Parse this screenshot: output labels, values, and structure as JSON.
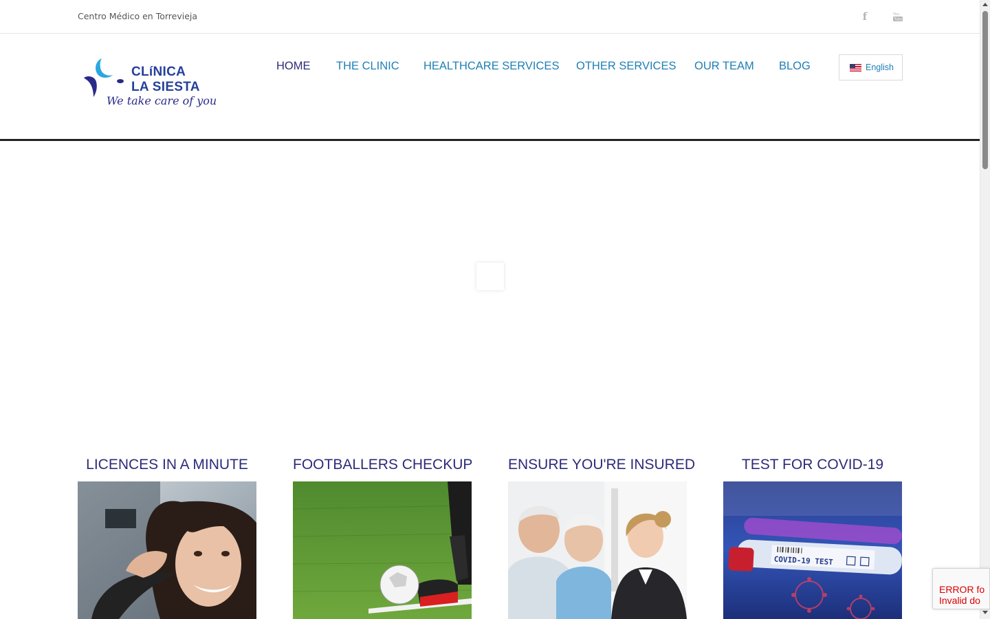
{
  "topbar": {
    "tagline": "Centro Médico en Torrevieja",
    "social": [
      {
        "name": "facebook-icon",
        "glyph": "f"
      },
      {
        "name": "youtube-icon",
        "glyph": "You"
      }
    ]
  },
  "logo": {
    "word1": "CLíNICA",
    "word2": "LA SIESTA",
    "slogan": "We take care of you",
    "colors": {
      "blue": "#253f9b",
      "light_blue": "#29a8e0",
      "navy": "#2a2a8a"
    }
  },
  "nav": {
    "items": [
      {
        "label": "HOME",
        "active": true
      },
      {
        "label": "THE CLINIC",
        "active": false
      },
      {
        "label": "HEALTHCARE SERVICES",
        "active": false
      },
      {
        "label": "OTHER SERVICES",
        "active": false
      },
      {
        "label": "OUR TEAM",
        "active": false
      },
      {
        "label": "BLOG",
        "active": false
      }
    ],
    "language": {
      "label": "English",
      "flag": "us-flag-icon"
    }
  },
  "cards": [
    {
      "title": "LICENCES IN A MINUTE",
      "image": "woman-driving-car"
    },
    {
      "title": "FOOTBALLERS CHECKUP",
      "image": "football-on-grass"
    },
    {
      "title": "ENSURE YOU'RE INSURED",
      "image": "elderly-couple-with-advisor"
    },
    {
      "title": "TEST FOR COVID-19",
      "image": "covid-test-tube"
    }
  ],
  "covid_tube_label": "COVID-19 TEST",
  "recaptcha": {
    "line1": "ERROR fo",
    "line2": "Invalid do"
  },
  "colors": {
    "nav_link": "#1d7fb5",
    "nav_active": "#2b2b7a",
    "card_title": "#2b2b7a",
    "header_rule": "#222222"
  }
}
